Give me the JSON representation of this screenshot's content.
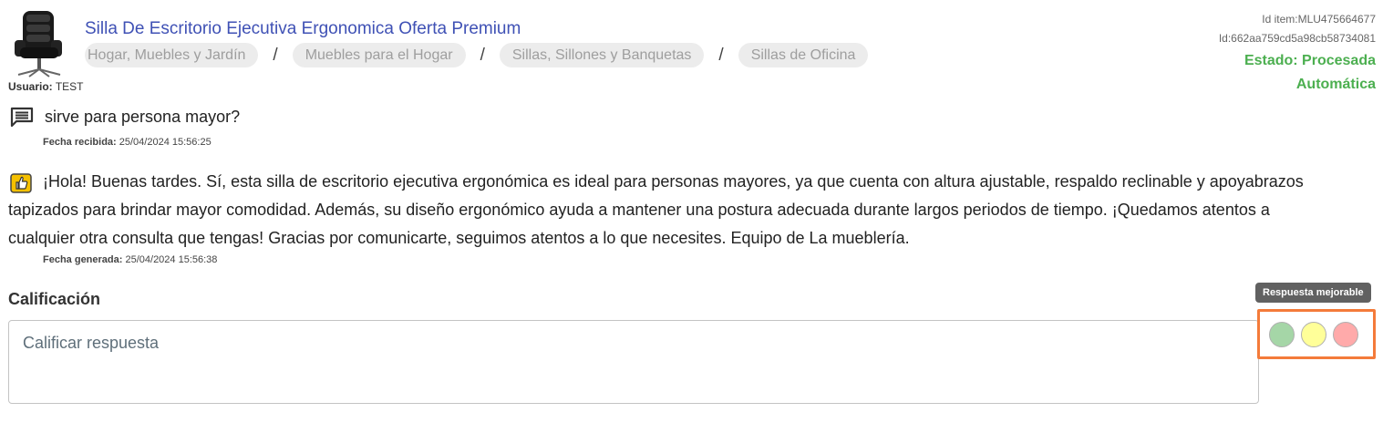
{
  "product": {
    "title": "Silla De Escritorio Ejecutiva Ergonomica Oferta Premium",
    "image_icon": "office-chair-image",
    "breadcrumb": [
      "Hogar, Muebles y Jardín",
      "Muebles para el Hogar",
      "Sillas, Sillones y Banquetas",
      "Sillas de Oficina"
    ],
    "breadcrumb_separator": "/"
  },
  "user": {
    "label": "Usuario:",
    "value": "TEST"
  },
  "ids": {
    "item_id": "Id item:MLU475664677",
    "id": "Id:662aa759cd5a98cb58734081"
  },
  "status": {
    "line1": "Estado: Procesada",
    "line2": "Automática",
    "color": "#4caf50"
  },
  "question": {
    "icon": "message-icon",
    "text": "sirve para persona mayor?",
    "date_label": "Fecha recibida:",
    "date_value": "25/04/2024 15:56:25"
  },
  "answer": {
    "icon": "thumbs-up-icon",
    "text": "¡Hola! Buenas tardes. Sí, esta silla de escritorio ejecutiva ergonómica es ideal para personas mayores, ya que cuenta con altura ajustable, respaldo reclinable y apoyabrazos tapizados para brindar mayor comodidad. Además, su diseño ergonómico ayuda a mantener una postura adecuada durante largos periodos de tiempo. ¡Quedamos atentos a cualquier otra consulta que tengas! Gracias por comunicarte, seguimos atentos a lo que necesites. Equipo de La mueblería.",
    "date_label": "Fecha generada:",
    "date_value": "25/04/2024 15:56:38"
  },
  "rating": {
    "title": "Calificación",
    "placeholder": "Calificar respuesta",
    "tooltip": "Respuesta mejorable",
    "colors": [
      "#a5d6a7",
      "#ffff99",
      "#ffaaaa"
    ],
    "highlight_color": "#f47b3a"
  }
}
